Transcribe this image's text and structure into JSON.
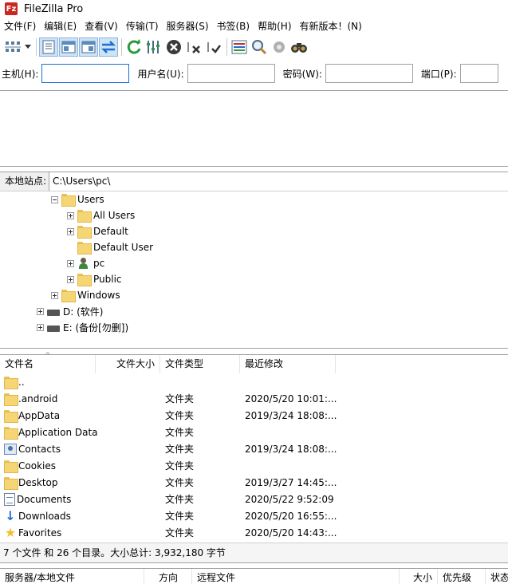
{
  "window": {
    "title": "FileZilla Pro"
  },
  "menu": [
    "文件(F)",
    "编辑(E)",
    "查看(V)",
    "传输(T)",
    "服务器(S)",
    "书签(B)",
    "帮助(H)",
    "有新版本！(N)"
  ],
  "quickconnect": {
    "host_label": "主机(H):",
    "user_label": "用户名(U):",
    "pass_label": "密码(W):",
    "port_label": "端口(P):",
    "host_value": "",
    "user_value": "",
    "pass_value": "",
    "port_value": ""
  },
  "local": {
    "label": "本地站点:",
    "path": "C:\\Users\\pc\\"
  },
  "tree": [
    {
      "label": "Users",
      "expander": "minus"
    },
    {
      "label": "All Users",
      "expander": "plus"
    },
    {
      "label": "Default",
      "expander": "plus"
    },
    {
      "label": "Default User",
      "expander": "none"
    },
    {
      "label": "pc",
      "expander": "plus"
    },
    {
      "label": "Public",
      "expander": "plus"
    },
    {
      "label": "Windows",
      "expander": "plus"
    },
    {
      "label": "D: (软件)",
      "expander": "plus"
    },
    {
      "label": "E: (备份[勿删])",
      "expander": "plus"
    }
  ],
  "list_columns": {
    "name": "文件名",
    "size": "文件大小",
    "type": "文件类型",
    "modified": "最近修改"
  },
  "files": [
    {
      "name": "..",
      "type": "",
      "modified": ""
    },
    {
      "name": ".android",
      "type": "文件夹",
      "modified": "2020/5/20 10:01:..."
    },
    {
      "name": "AppData",
      "type": "文件夹",
      "modified": "2019/3/24 18:08:..."
    },
    {
      "name": "Application Data",
      "type": "文件夹",
      "modified": ""
    },
    {
      "name": "Contacts",
      "type": "文件夹",
      "modified": "2019/3/24 18:08:..."
    },
    {
      "name": "Cookies",
      "type": "文件夹",
      "modified": ""
    },
    {
      "name": "Desktop",
      "type": "文件夹",
      "modified": "2019/3/27 14:45:..."
    },
    {
      "name": "Documents",
      "type": "文件夹",
      "modified": "2020/5/22 9:52:09"
    },
    {
      "name": "Downloads",
      "type": "文件夹",
      "modified": "2020/5/20 16:55:..."
    },
    {
      "name": "Favorites",
      "type": "文件夹",
      "modified": "2020/5/20 14:43:..."
    }
  ],
  "status": "7 个文件 和 26 个目录。大小总计: 3,932,180 字节",
  "queue_columns": {
    "server": "服务器/本地文件",
    "direction": "方向",
    "remote": "远程文件",
    "size": "大小",
    "priority": "优先级",
    "state": "状态"
  },
  "icons": {
    "toolbar": [
      "site-manager-icon",
      "dropdown-arrow-icon",
      "toggle-log-icon",
      "toggle-local-tree-icon",
      "toggle-remote-tree-icon",
      "toggle-queue-icon",
      "refresh-icon",
      "process-queue-icon",
      "cancel-icon",
      "disconnect-icon",
      "reconnect-icon",
      "directory-listing-filter-icon",
      "toggle-sync-browsing-icon",
      "dir-compare-icon",
      "search-remote-icon"
    ],
    "accent": "#1a6fd1"
  }
}
